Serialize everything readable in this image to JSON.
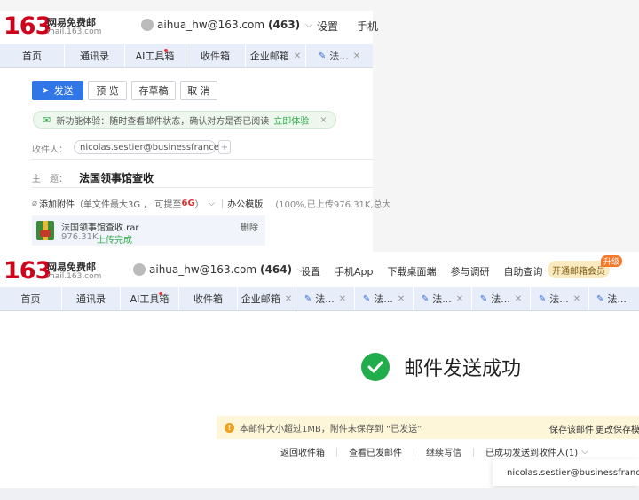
{
  "logo": {
    "number": "163",
    "name_cn": "网易免费邮",
    "domain": "mail.163.com"
  },
  "colors": {
    "brand_red": "#d0021b",
    "tab_bg": "#e7eef9",
    "primary": "#3176e6",
    "success_green": "#22ad4c"
  },
  "compose_view": {
    "account": {
      "email": "aihua_hw@163.com",
      "count": "(463)"
    },
    "top_nav": [
      "设置",
      "手机"
    ],
    "tabs": [
      "首页",
      "通讯录",
      "AI工具箱",
      "收件箱",
      "企业邮箱",
      "法..."
    ],
    "toolbar": {
      "send": "发送",
      "preview": "预 览",
      "save_draft": "存草稿",
      "cancel": "取 消"
    },
    "notice": {
      "text": "新功能体验：随时查看邮件状态，确认对方是否已阅读",
      "link": "立即体验",
      "close": "×"
    },
    "recipient": {
      "label": "收件人：",
      "email": "nicolas.sestier@businessfrance.fr",
      "add": "+"
    },
    "subject": {
      "label": "主　题：",
      "value": "法国领事馆查收"
    },
    "attach": {
      "link": "添加附件",
      "hint": "（单文件最大3G ， 可提至",
      "hint_red": "6G",
      "hint_end": "）",
      "office": "办公模版",
      "progress": "(100%,已上传976.31K,总大"
    },
    "file": {
      "name": "法国领事馆查收.rar",
      "size": "976.31K",
      "status": "上传完成",
      "delete": "删除"
    }
  },
  "success_view": {
    "account": {
      "email": "aihua_hw@163.com",
      "count": "(464)"
    },
    "top_nav": [
      "设置",
      "手机App",
      "下载桌面端",
      "参与调研",
      "自助查询"
    ],
    "vip": {
      "label": "开通邮箱会员",
      "badge": "升级"
    },
    "tabs": [
      "首页",
      "通讯录",
      "AI工具箱",
      "收件箱",
      "企业邮箱",
      "法...",
      "法...",
      "法...",
      "法...",
      "法...",
      "法..."
    ],
    "message": "邮件发送成功",
    "warning": {
      "icon": "!",
      "text": "本邮件大小超过1MB，附件未保存到 “已发送”",
      "save": "保存该邮件",
      "change": "更改保存模"
    },
    "actions": [
      "返回收件箱",
      "查看已发邮件",
      "继续写信",
      "已成功发送到收件人(1)"
    ],
    "sent_to": "nicolas.sestier@businessfrance.fr"
  }
}
